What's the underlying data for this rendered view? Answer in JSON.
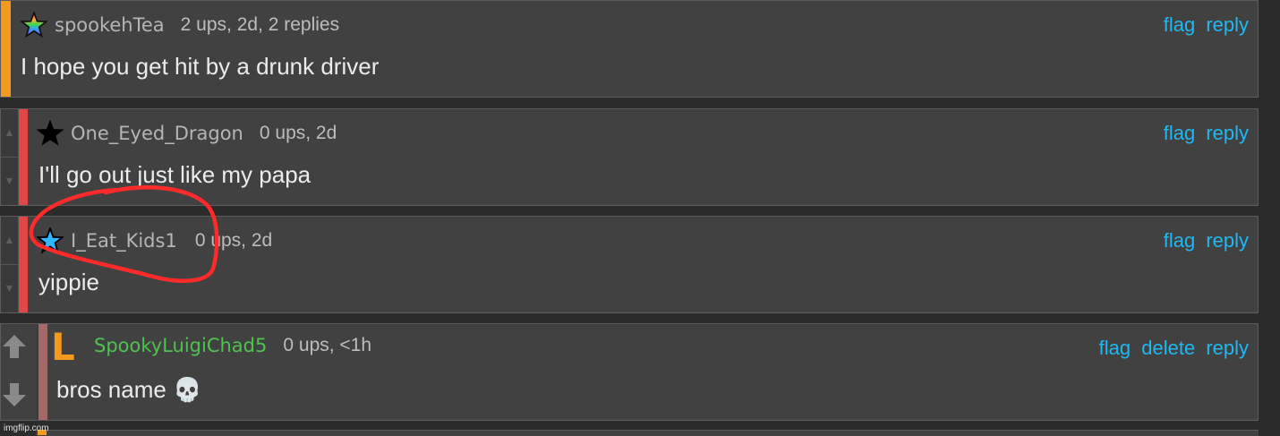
{
  "comments": [
    {
      "username": "spookehTea",
      "meta": "2 ups, 2d, 2 replies",
      "text": "I hope you get hit by a drunk driver",
      "actions": [
        "flag",
        "reply"
      ],
      "star": "rainbow-star-icon"
    },
    {
      "username": "One_Eyed_Dragon",
      "meta": "0 ups, 2d",
      "text": "I'll go out just like my papa",
      "actions": [
        "flag",
        "reply"
      ],
      "star": "black-star-icon"
    },
    {
      "username": "I_Eat_Kids1",
      "meta": "0 ups, 2d",
      "text": "yippie",
      "actions": [
        "flag",
        "reply"
      ],
      "star": "blue-star-icon"
    },
    {
      "username": "SpookyLuigiChad5",
      "meta": "0 ups, <1h",
      "text": "bros name 💀",
      "actions": [
        "flag",
        "delete",
        "reply"
      ],
      "icon": "orange-l-icon",
      "icon_letter": "L"
    }
  ],
  "colors": {
    "accent_link": "#21b8f2",
    "username_green": "#4fc24f",
    "orange_bar": "#f39a1e",
    "red_bar": "#e04848",
    "annotation_red": "#ff2a2a"
  },
  "watermark": "imgflip.com"
}
